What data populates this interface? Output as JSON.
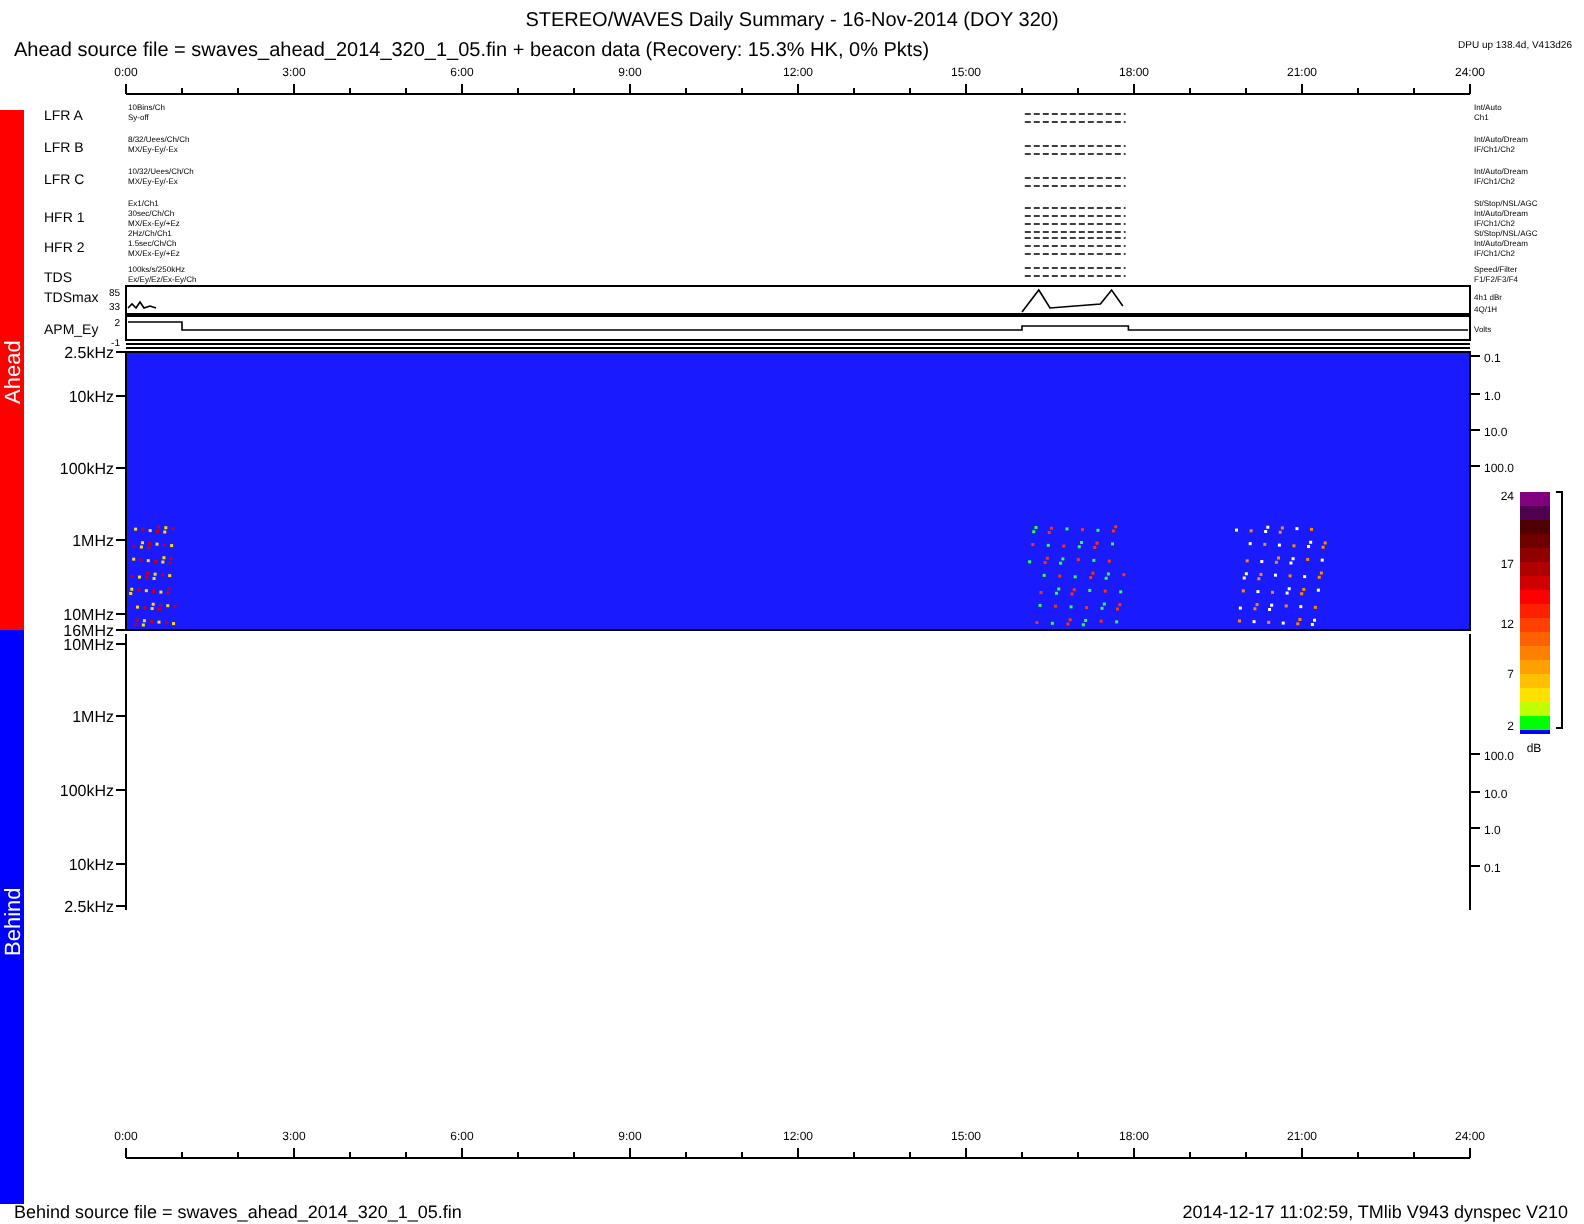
{
  "title": "STEREO/WAVES Daily Summary - 16-Nov-2014 (DOY 320)",
  "ahead_source": "Ahead source file = swaves_ahead_2014_320_1_05.fin + beacon data (Recovery: 15.3% HK,   0% Pkts)",
  "dpu_status": "DPU up 138.4d, V413d26",
  "time_labels_top": [
    "0:00",
    "3:00",
    "6:00",
    "9:00",
    "12:00",
    "15:00",
    "18:00",
    "21:00",
    "24:00"
  ],
  "instruments": [
    {
      "label": "LFR A",
      "modes": [
        "10Bins/Ch",
        "Sy-off"
      ],
      "settings": [
        "Int/Auto",
        "Ch1"
      ]
    },
    {
      "label": "LFR B",
      "modes": [
        "8/32/Uees/Ch/Ch",
        "MX/Ey-Ey/-Ex"
      ],
      "settings": [
        "Int/Auto/Dream",
        "IF/Ch1/Ch2"
      ]
    },
    {
      "label": "LFR C",
      "modes": [
        "10/32/Uees/Ch/Ch",
        "MX/Ey-Ey/-Ex"
      ],
      "settings": [
        "Int/Auto/Dream",
        "IF/Ch1/Ch2"
      ]
    },
    {
      "label": "HFR 1",
      "modes": [
        "Ex1/Ch1",
        "30sec/Ch/Ch",
        "MX/Ex-Ey/+Ez"
      ],
      "settings": [
        "St/Stop/NSL/AGC",
        "Int/Auto/Dream",
        "IF/Ch1/Ch2"
      ]
    },
    {
      "label": "HFR 2",
      "modes": [
        "2Hz/Ch/Ch1",
        "1.5sec/Ch/Ch",
        "MX/Ex-Ey/+Ez"
      ],
      "settings": [
        "St/Stop/NSL/AGC",
        "Int/Auto/Dream",
        "IF/Ch1/Ch2"
      ]
    },
    {
      "label": "TDS",
      "modes": [
        "100ks/s/250kHz",
        "Ex/Ey/Ez/Ex-Ey/Ch"
      ],
      "settings": [
        "Speed/Filter",
        "F1/F2/F3/F4"
      ]
    }
  ],
  "tdsmax": {
    "label": "TDSmax",
    "scale": [
      "85",
      "33"
    ],
    "units": [
      "4h1 dBr",
      "4Q/1H"
    ]
  },
  "apm": {
    "label": "APM_Ey",
    "scale": [
      "2",
      "-1"
    ],
    "units": [
      "Volts"
    ]
  },
  "ahead": {
    "label": "Ahead",
    "freq_labels": [
      "2.5kHz",
      "10kHz",
      "100kHz",
      "1MHz",
      "10MHz",
      "16MHz"
    ],
    "right_labels": [
      "0.1",
      "1.0",
      "10.0",
      "100.0"
    ]
  },
  "behind": {
    "label": "Behind",
    "freq_labels": [
      "10MHz",
      "1MHz",
      "100kHz",
      "10kHz",
      "2.5kHz"
    ],
    "right_labels": [
      "100.0",
      "10.0",
      "1.0",
      "0.1"
    ]
  },
  "colorbar": {
    "ticks": [
      "24",
      "17",
      "12",
      "7",
      "2"
    ],
    "unit": "dB"
  },
  "time_labels_bottom": [
    "0:00",
    "3:00",
    "6:00",
    "9:00",
    "12:00",
    "15:00",
    "18:00",
    "21:00",
    "24:00"
  ],
  "behind_source": "Behind source file = swaves_ahead_2014_320_1_05.fin",
  "generated": "2014-12-17 11:02:59, TMlib V943 dynspec V210"
}
